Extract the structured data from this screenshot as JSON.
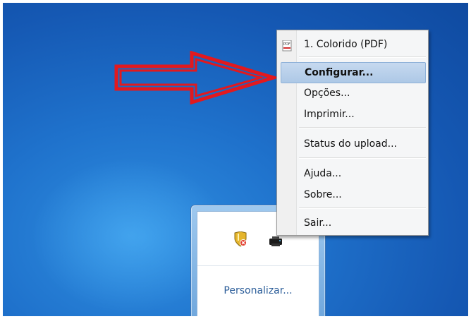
{
  "menu": {
    "items": [
      {
        "label": "1. Colorido (PDF)"
      },
      {
        "label": "Configurar..."
      },
      {
        "label": "Opções..."
      },
      {
        "label": "Imprimir..."
      },
      {
        "label": "Status do upload..."
      },
      {
        "label": "Ajuda..."
      },
      {
        "label": "Sobre..."
      },
      {
        "label": "Sair..."
      }
    ],
    "highlighted_index": 1,
    "colors": {
      "highlight": "#c6d9ef",
      "arrow": "#e2191e"
    }
  },
  "tray": {
    "customize_link": "Personalizar..."
  },
  "icons": {
    "menu_header": "pdf-printer-icon",
    "tray": [
      "shield-icon",
      "printer-icon"
    ],
    "annotation": "red-arrow-icon"
  }
}
